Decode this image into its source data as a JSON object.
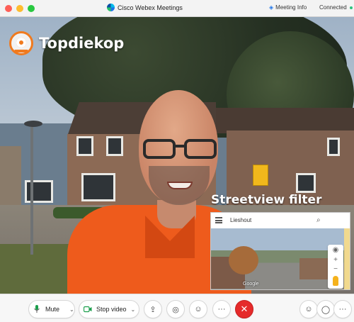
{
  "window": {
    "app_title": "Cisco Webex Meetings",
    "meeting_info_label": "Meeting Info",
    "connection_status": "Connected"
  },
  "overlay": {
    "brand_text": "Topdiekop",
    "filter_label": "Streetview filter"
  },
  "streetview": {
    "place": "Lieshout",
    "search_icon": "⌕",
    "google_label": "Google",
    "zoom_in": "+",
    "zoom_out": "−",
    "compass_icon": "◉"
  },
  "toolbar": {
    "mute_label": "Mute",
    "stop_video_label": "Stop video",
    "share_icon": "⇪",
    "record_icon": "◎",
    "reactions_icon": "☺",
    "more_icon": "···",
    "end_icon": "✕",
    "participants_icon": "☺",
    "chat_icon": "◯",
    "more_right_icon": "···",
    "chevron": "⌄"
  }
}
